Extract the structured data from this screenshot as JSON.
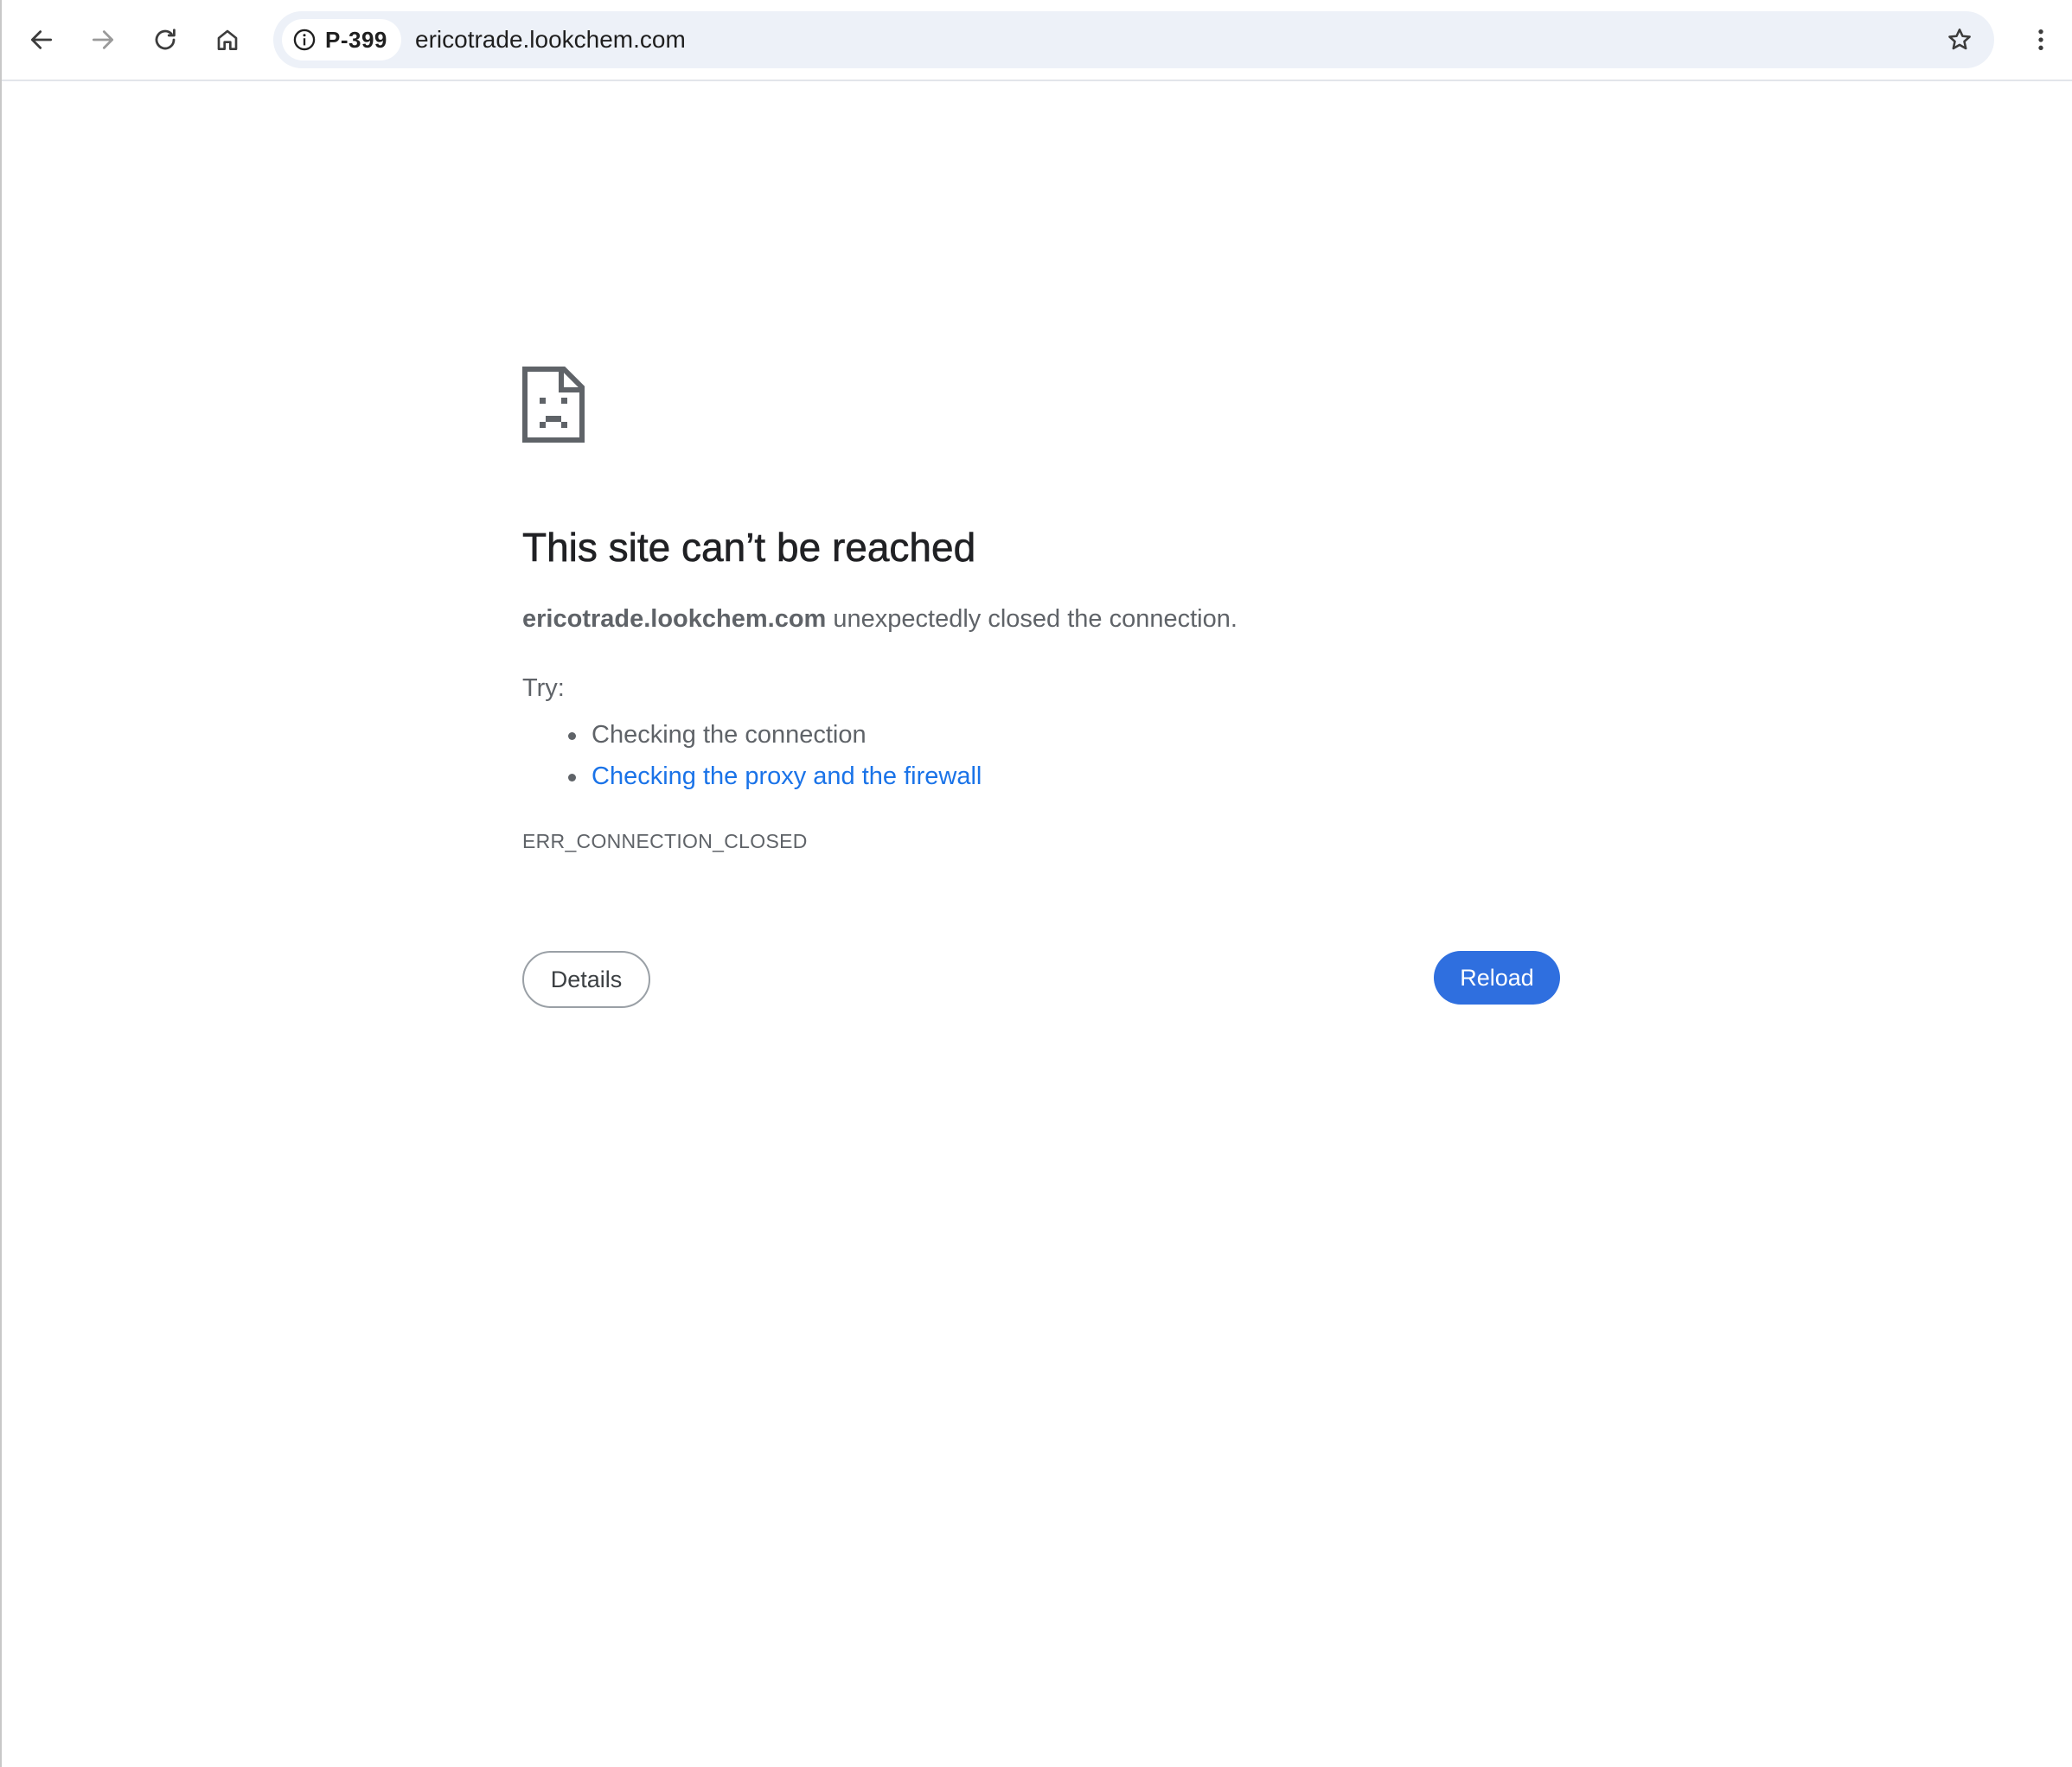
{
  "toolbar": {
    "back_icon": "arrow-left-icon",
    "forward_icon": "arrow-right-icon",
    "reload_icon": "reload-icon",
    "home_icon": "home-icon",
    "site_info_icon": "info-icon",
    "profile_chip": "P-399",
    "url": "ericotrade.lookchem.com",
    "bookmark_icon": "star-icon",
    "menu_icon": "kebab-menu-icon"
  },
  "error_page": {
    "icon": "sad-page-icon",
    "title": "This site can’t be reached",
    "host": "ericotrade.lookchem.com",
    "message": " unexpectedly closed the connection.",
    "try_label": "Try:",
    "suggestions": [
      "Checking the connection",
      "Checking the proxy and the firewall"
    ],
    "error_code": "ERR_CONNECTION_CLOSED",
    "details_label": "Details",
    "reload_label": "Reload"
  },
  "colors": {
    "link": "#1a73e8",
    "primary_button": "#2f6fdf",
    "omnibox_bg": "#edf1f8",
    "text_secondary": "#5f6368"
  }
}
